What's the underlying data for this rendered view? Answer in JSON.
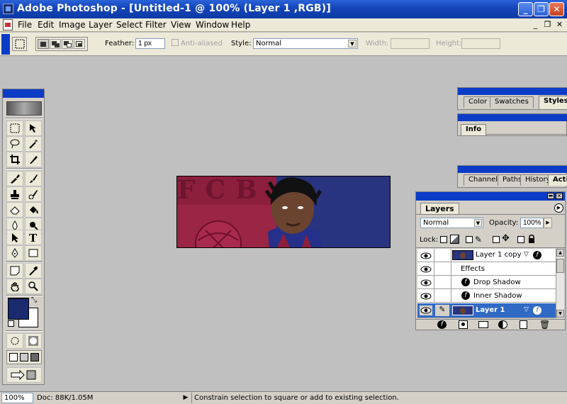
{
  "app": {
    "title": "Adobe Photoshop - [Untitled-1 @ 100% (Layer 1 ,RGB)]",
    "window_controls": {
      "minimize": "_",
      "maximize": "❐",
      "close": "✕"
    }
  },
  "menubar": {
    "items": [
      "File",
      "Edit",
      "Image",
      "Layer",
      "Select",
      "Filter",
      "View",
      "Window",
      "Help"
    ],
    "doc_controls": {
      "minimize": "_",
      "restore": "❐",
      "close": "✕"
    }
  },
  "options": {
    "feather_label": "Feather:",
    "feather_value": "1 px",
    "antialias_label": "Anti-aliased",
    "style_label": "Style:",
    "style_value": "Normal",
    "width_label": "Width:",
    "height_label": "Height:"
  },
  "panels": {
    "color_tabs": [
      "Color",
      "Swatches",
      "Styles"
    ],
    "info_tabs": [
      "Info"
    ],
    "channels_tabs": [
      "Channels",
      "Paths",
      "History",
      "Actio"
    ]
  },
  "layers": {
    "tab": "Layers",
    "blend_mode": "Normal",
    "opacity_label": "Opacity:",
    "opacity_value": "100%",
    "lock_label": "Lock:",
    "rows": [
      {
        "name": "Layer 1 copy",
        "selected": false,
        "type": "layer"
      },
      {
        "name": "Effects",
        "selected": false,
        "type": "effects"
      },
      {
        "name": "Drop Shadow",
        "selected": false,
        "type": "effect"
      },
      {
        "name": "Inner Shadow",
        "selected": false,
        "type": "effect"
      },
      {
        "name": "Layer 1",
        "selected": true,
        "type": "layer"
      }
    ]
  },
  "canvas": {
    "image_text": "FCB"
  },
  "colors": {
    "foreground": "#1a2a6e",
    "background": "#ffffff",
    "titlebar": "#0c3aa6",
    "selection": "#316ac5"
  },
  "status": {
    "zoom": "100%",
    "doc": "Doc: 88K/1.05M",
    "arrow": "▶",
    "hint": "Constrain selection to square or add to existing selection."
  }
}
